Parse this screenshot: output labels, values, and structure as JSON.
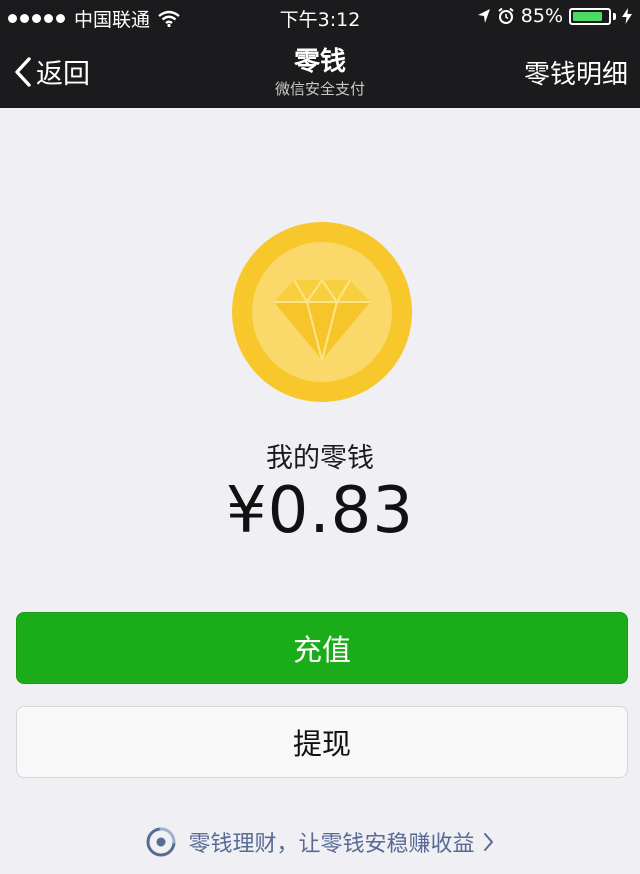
{
  "status_bar": {
    "carrier": "中国联通",
    "time": "下午3:12",
    "battery_percent": "85%",
    "battery_level": 0.85,
    "icons": [
      "signal-dots",
      "wifi-icon",
      "location-arrow-icon",
      "alarm-icon",
      "battery-icon",
      "charging-bolt-icon"
    ]
  },
  "nav": {
    "back_label": "返回",
    "title": "零钱",
    "subtitle": "微信安全支付",
    "detail_label": "零钱明细"
  },
  "wallet": {
    "icon": "diamond-coin-icon",
    "label": "我的零钱",
    "balance": "¥0.83"
  },
  "actions": {
    "recharge_label": "充值",
    "withdraw_label": "提现"
  },
  "footer": {
    "wealth_link": "零钱理财，让零钱安稳赚收益"
  },
  "colors": {
    "nav_background": "#1b1b1d",
    "page_background": "#efeff4",
    "primary_green": "#1aad19",
    "coin_yellow": "#f7c72b",
    "link_blue": "#576b95"
  }
}
